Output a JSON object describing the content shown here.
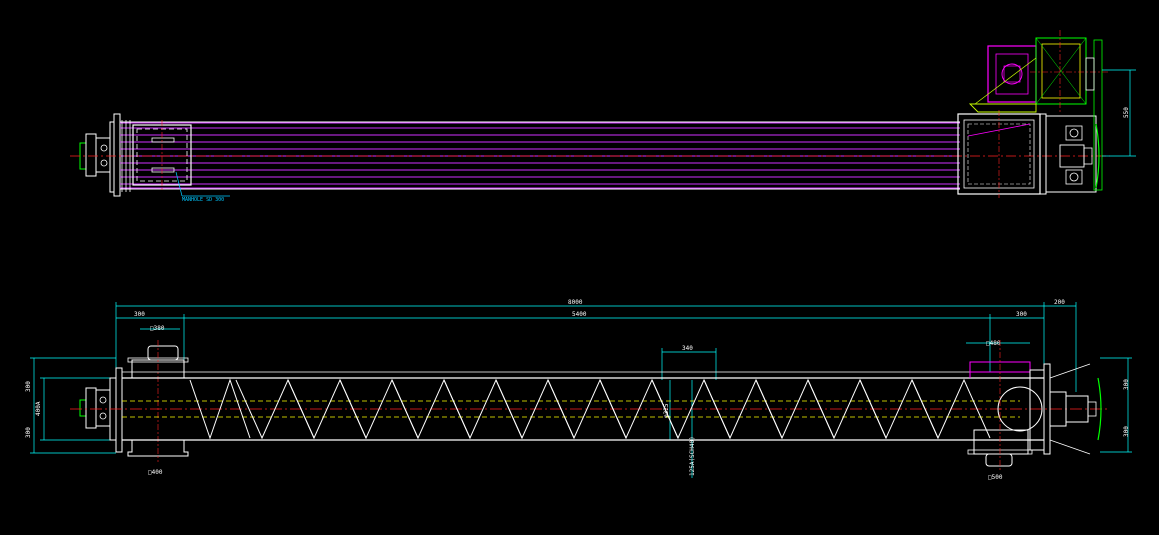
{
  "colors": {
    "background": "#000000",
    "outline": "#ffffff",
    "dimension": "#00ffff",
    "centerline": "#ff2020",
    "auger": "#ffff00",
    "trough_lines": "#d030ff",
    "motor": "#ff00ff",
    "drive": "#00ff00",
    "yellow_green": "#c8ff00"
  },
  "top_view": {
    "manhole_label": "MANHOLE SD 300",
    "dim_height_drive": "550"
  },
  "side_view": {
    "dim_overall": "8000",
    "dim_pitch_span": "5400",
    "dim_left_end": "300",
    "dim_right_end": "300",
    "dim_drive_overhang": "200",
    "dim_inlet_left": "□380",
    "dim_inlet_left_bottom": "□400",
    "dim_outlet_right_top": "□480",
    "dim_outlet_right_bottom": "□500",
    "dim_pitch": "340",
    "dim_shaft": "φ325",
    "dim_flight": "125A(SCH40)",
    "dim_left_height_1": "300",
    "dim_left_height_2": "400A",
    "dim_left_height_3": "300",
    "dim_right_height_1": "300",
    "dim_right_height_2": "300"
  }
}
